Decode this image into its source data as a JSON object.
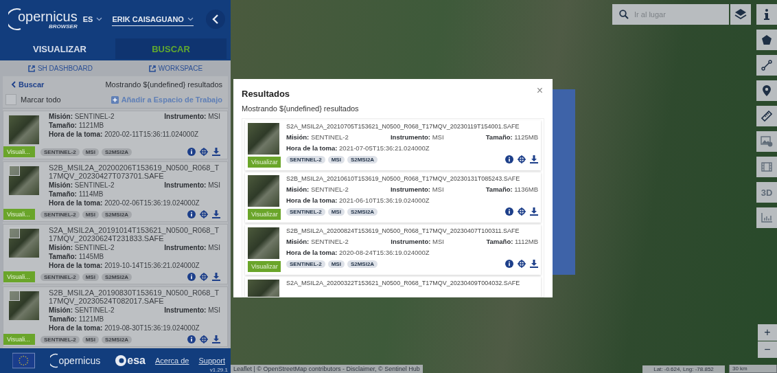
{
  "header": {
    "logo_text": "opernicus",
    "logo_subtitle": "BROWSER",
    "language": "ES",
    "user": "ERIK CAISAGUANO"
  },
  "tabs": [
    {
      "label": "VISUALIZAR",
      "selected": false
    },
    {
      "label": "BUSCAR",
      "selected": true
    }
  ],
  "links": [
    "SH DASHBOARD",
    "WORKSPACE"
  ],
  "search_panel": {
    "back": "Buscar",
    "summary": "Mostrando ${undefined} resultados",
    "select_all": {
      "label": "Marcar todo",
      "checked": false
    },
    "add_to_workspace": "Añadir a Espacio de Trabajo"
  },
  "side_results": [
    {
      "mission": {
        "label": "Misión:",
        "value": "SENTINEL-2"
      },
      "instrument": {
        "label": "Instrumento:",
        "value": "MSI"
      },
      "size": {
        "label": "Tamaño:",
        "value": "1121MB"
      },
      "time": {
        "label": "Hora de la toma:",
        "value": "2020-02-11T15:36:11.024000Z"
      },
      "button": "Visuali...",
      "tags": [
        "SENTINEL-2",
        "MSI",
        "S2MSI2A"
      ]
    },
    {
      "title": "S2B_MSIL2A_20200206T153619_N0500_R068_T17MQV_20230427T073701.SAFE",
      "checked": false,
      "mission": {
        "label": "Misión:",
        "value": "SENTINEL-2"
      },
      "instrument": {
        "label": "Instrumento:",
        "value": "MSI"
      },
      "size": {
        "label": "Tamaño:",
        "value": "1114MB"
      },
      "time": {
        "label": "Hora de la toma:",
        "value": "2020-02-06T15:36:19.024000Z"
      },
      "button": "Visuali...",
      "tags": [
        "SENTINEL-2",
        "MSI",
        "S2MSI2A"
      ]
    },
    {
      "title": "S2A_MSIL2A_20191014T153621_N0500_R068_T17MQV_20230624T231833.SAFE",
      "checked": false,
      "mission": {
        "label": "Misión:",
        "value": "SENTINEL-2"
      },
      "instrument": {
        "label": "Instrumento:",
        "value": "MSI"
      },
      "size": {
        "label": "Tamaño:",
        "value": "1145MB"
      },
      "time": {
        "label": "Hora de la toma:",
        "value": "2019-10-14T15:36:21.024000Z"
      },
      "button": "Visuali...",
      "tags": [
        "SENTINEL-2",
        "MSI",
        "S2MSI2A"
      ]
    },
    {
      "title": "S2B_MSIL2A_20190830T153619_N0500_R068_T17MQV_20230524T082017.SAFE",
      "checked": false,
      "mission": {
        "label": "Misión:",
        "value": "SENTINEL-2"
      },
      "instrument": {
        "label": "Instrumento:",
        "value": "MSI"
      },
      "size": {
        "label": "Tamaño:",
        "value": "1121MB"
      },
      "time": {
        "label": "Hora de la toma:",
        "value": "2019-08-30T15:36:19.024000Z"
      },
      "button": "Visuali...",
      "tags": [
        "SENTINEL-2",
        "MSI",
        "S2MSI2A"
      ]
    }
  ],
  "footer": {
    "logo_text": "opernicus",
    "esa": "esa",
    "links": [
      "Acerca de",
      "Support"
    ],
    "version": "v1.29.1"
  },
  "map": {
    "search_placeholder": "Ir al lugar",
    "tool_3d": "3D",
    "zoom_in": "+",
    "zoom_out": "−",
    "coordinates": "Lat: -0.624, Lng: -78.852",
    "scale": "30 km",
    "attribution": "Leaflet | © OpenStreetMap contributors - Disclaimer, © Sentinel Hub"
  },
  "modal": {
    "title": "Resultados",
    "close": "×",
    "summary": "Mostrando ${undefined} resultados",
    "results": [
      {
        "title": "S2A_MSIL2A_20210705T153621_N0500_R068_T17MQV_20230119T154001.SAFE",
        "mission": {
          "label": "Misión:",
          "value": "SENTINEL-2"
        },
        "instrument": {
          "label": "Instrumento:",
          "value": "MSI"
        },
        "size": {
          "label": "Tamaño:",
          "value": "1125MB"
        },
        "time": {
          "label": "Hora de la toma:",
          "value": "2021-07-05T15:36:21.024000Z"
        },
        "button": "Visualizar",
        "tags": [
          "SENTINEL-2",
          "MSI",
          "S2MSI2A"
        ]
      },
      {
        "title": "S2B_MSIL2A_20210610T153619_N0500_R068_T17MQV_20230131T085243.SAFE",
        "mission": {
          "label": "Misión:",
          "value": "SENTINEL-2"
        },
        "instrument": {
          "label": "Instrumento:",
          "value": "MSI"
        },
        "size": {
          "label": "Tamaño:",
          "value": "1136MB"
        },
        "time": {
          "label": "Hora de la toma:",
          "value": "2021-06-10T15:36:19.024000Z"
        },
        "button": "Visualizar",
        "tags": [
          "SENTINEL-2",
          "MSI",
          "S2MSI2A"
        ]
      },
      {
        "title": "S2B_MSIL2A_20200824T153619_N0500_R068_T17MQV_20230407T100311.SAFE",
        "mission": {
          "label": "Misión:",
          "value": "SENTINEL-2"
        },
        "instrument": {
          "label": "Instrumento:",
          "value": "MSI"
        },
        "size": {
          "label": "Tamaño:",
          "value": "1112MB"
        },
        "time": {
          "label": "Hora de la toma:",
          "value": "2020-08-24T15:36:19.024000Z"
        },
        "button": "Visualizar",
        "tags": [
          "SENTINEL-2",
          "MSI",
          "S2MSI2A"
        ]
      },
      {
        "title": "S2A_MSIL2A_20200322T153621_N0500_R068_T17MQV_20230409T004032.SAFE"
      }
    ]
  }
}
